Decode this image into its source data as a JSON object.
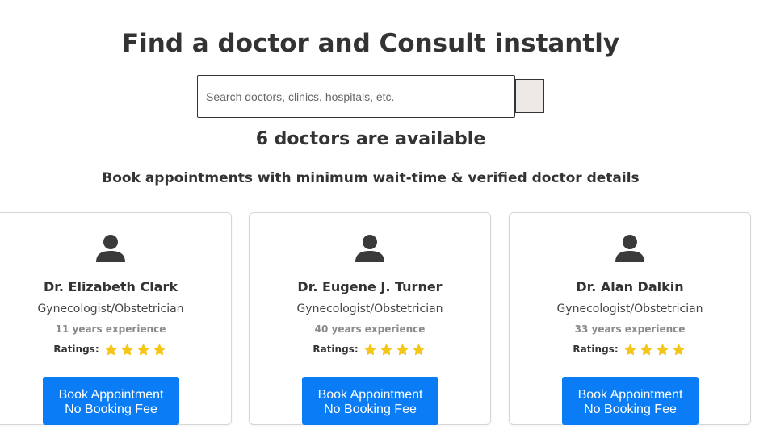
{
  "page": {
    "title": "Find a doctor and Consult instantly",
    "available_count_text": "6 doctors are available",
    "subheading": "Book appointments with minimum wait-time & verified doctor details"
  },
  "search": {
    "placeholder": "Search doctors, clinics, hospitals, etc.",
    "value": ""
  },
  "colors": {
    "button_blue": "#0a7cf5",
    "star_gold": "#f5c518",
    "avatar_dark": "#3a3a3a"
  },
  "doctors": [
    {
      "name": "Dr. Elizabeth Clark",
      "specialty": "Gynecologist/Obstetrician",
      "experience": "11 years experience",
      "ratings_label": "Ratings:",
      "stars": 4,
      "button_line1": "Book Appointment",
      "button_line2": "No Booking Fee",
      "avatar_icon": "user-icon"
    },
    {
      "name": "Dr. Eugene J. Turner",
      "specialty": "Gynecologist/Obstetrician",
      "experience": "40 years experience",
      "ratings_label": "Ratings:",
      "stars": 4,
      "button_line1": "Book Appointment",
      "button_line2": "No Booking Fee",
      "avatar_icon": "user-icon"
    },
    {
      "name": "Dr. Alan Dalkin",
      "specialty": "Gynecologist/Obstetrician",
      "experience": "33 years experience",
      "ratings_label": "Ratings:",
      "stars": 4,
      "button_line1": "Book Appointment",
      "button_line2": "No Booking Fee",
      "avatar_icon": "user-icon"
    }
  ]
}
